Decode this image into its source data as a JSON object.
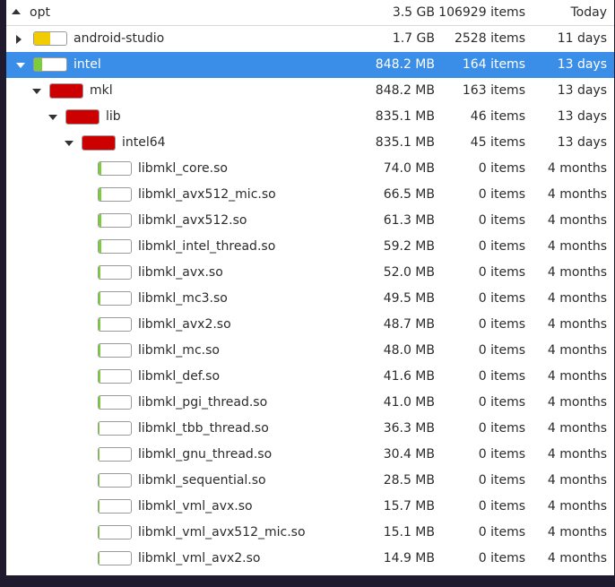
{
  "header": {
    "name": "opt",
    "size": "3.5 GB",
    "items": "106929 items",
    "modified": "Today"
  },
  "colors": {
    "selected": "#3b8ee8",
    "red": "#cc0000",
    "yellow": "#f0cc00",
    "green": "#7ccd3a"
  },
  "rows": [
    {
      "name": "android-studio",
      "size": "1.7 GB",
      "items": "2528 items",
      "modified": "11 days",
      "expander": "collapsed",
      "usage": 0.5,
      "usage_color": "yellow"
    },
    {
      "name": "intel",
      "size": "848.2 MB",
      "items": "164 items",
      "modified": "13 days",
      "expander": "expanded",
      "usage": 0.24,
      "usage_color": "green",
      "selected": true
    },
    {
      "name": "mkl",
      "size": "848.2 MB",
      "items": "163 items",
      "modified": "13 days",
      "expander": "expanded",
      "usage": 1.0,
      "usage_color": "red"
    },
    {
      "name": "lib",
      "size": "835.1 MB",
      "items": "46 items",
      "modified": "13 days",
      "expander": "expanded",
      "usage": 1.0,
      "usage_color": "red"
    },
    {
      "name": "intel64",
      "size": "835.1 MB",
      "items": "45 items",
      "modified": "13 days",
      "expander": "expanded",
      "usage": 1.0,
      "usage_color": "red"
    },
    {
      "name": "libmkl_core.so",
      "size": "74.0 MB",
      "items": "0 items",
      "modified": "4 months",
      "usage": 0.09,
      "usage_color": "green"
    },
    {
      "name": "libmkl_avx512_mic.so",
      "size": "66.5 MB",
      "items": "0 items",
      "modified": "4 months",
      "usage": 0.08,
      "usage_color": "green"
    },
    {
      "name": "libmkl_avx512.so",
      "size": "61.3 MB",
      "items": "0 items",
      "modified": "4 months",
      "usage": 0.07,
      "usage_color": "green"
    },
    {
      "name": "libmkl_intel_thread.so",
      "size": "59.2 MB",
      "items": "0 items",
      "modified": "4 months",
      "usage": 0.07,
      "usage_color": "green"
    },
    {
      "name": "libmkl_avx.so",
      "size": "52.0 MB",
      "items": "0 items",
      "modified": "4 months",
      "usage": 0.06,
      "usage_color": "green"
    },
    {
      "name": "libmkl_mc3.so",
      "size": "49.5 MB",
      "items": "0 items",
      "modified": "4 months",
      "usage": 0.06,
      "usage_color": "green"
    },
    {
      "name": "libmkl_avx2.so",
      "size": "48.7 MB",
      "items": "0 items",
      "modified": "4 months",
      "usage": 0.06,
      "usage_color": "green"
    },
    {
      "name": "libmkl_mc.so",
      "size": "48.0 MB",
      "items": "0 items",
      "modified": "4 months",
      "usage": 0.06,
      "usage_color": "green"
    },
    {
      "name": "libmkl_def.so",
      "size": "41.6 MB",
      "items": "0 items",
      "modified": "4 months",
      "usage": 0.05,
      "usage_color": "green"
    },
    {
      "name": "libmkl_pgi_thread.so",
      "size": "41.0 MB",
      "items": "0 items",
      "modified": "4 months",
      "usage": 0.05,
      "usage_color": "green"
    },
    {
      "name": "libmkl_tbb_thread.so",
      "size": "36.3 MB",
      "items": "0 items",
      "modified": "4 months",
      "usage": 0.04,
      "usage_color": "green"
    },
    {
      "name": "libmkl_gnu_thread.so",
      "size": "30.4 MB",
      "items": "0 items",
      "modified": "4 months",
      "usage": 0.04,
      "usage_color": "green"
    },
    {
      "name": "libmkl_sequential.so",
      "size": "28.5 MB",
      "items": "0 items",
      "modified": "4 months",
      "usage": 0.03,
      "usage_color": "green"
    },
    {
      "name": "libmkl_vml_avx.so",
      "size": "15.7 MB",
      "items": "0 items",
      "modified": "4 months",
      "usage": 0.02,
      "usage_color": "green"
    },
    {
      "name": "libmkl_vml_avx512_mic.so",
      "size": "15.1 MB",
      "items": "0 items",
      "modified": "4 months",
      "usage": 0.02,
      "usage_color": "green"
    },
    {
      "name": "libmkl_vml_avx2.so",
      "size": "14.9 MB",
      "items": "0 items",
      "modified": "4 months",
      "usage": 0.02,
      "usage_color": "green"
    }
  ]
}
